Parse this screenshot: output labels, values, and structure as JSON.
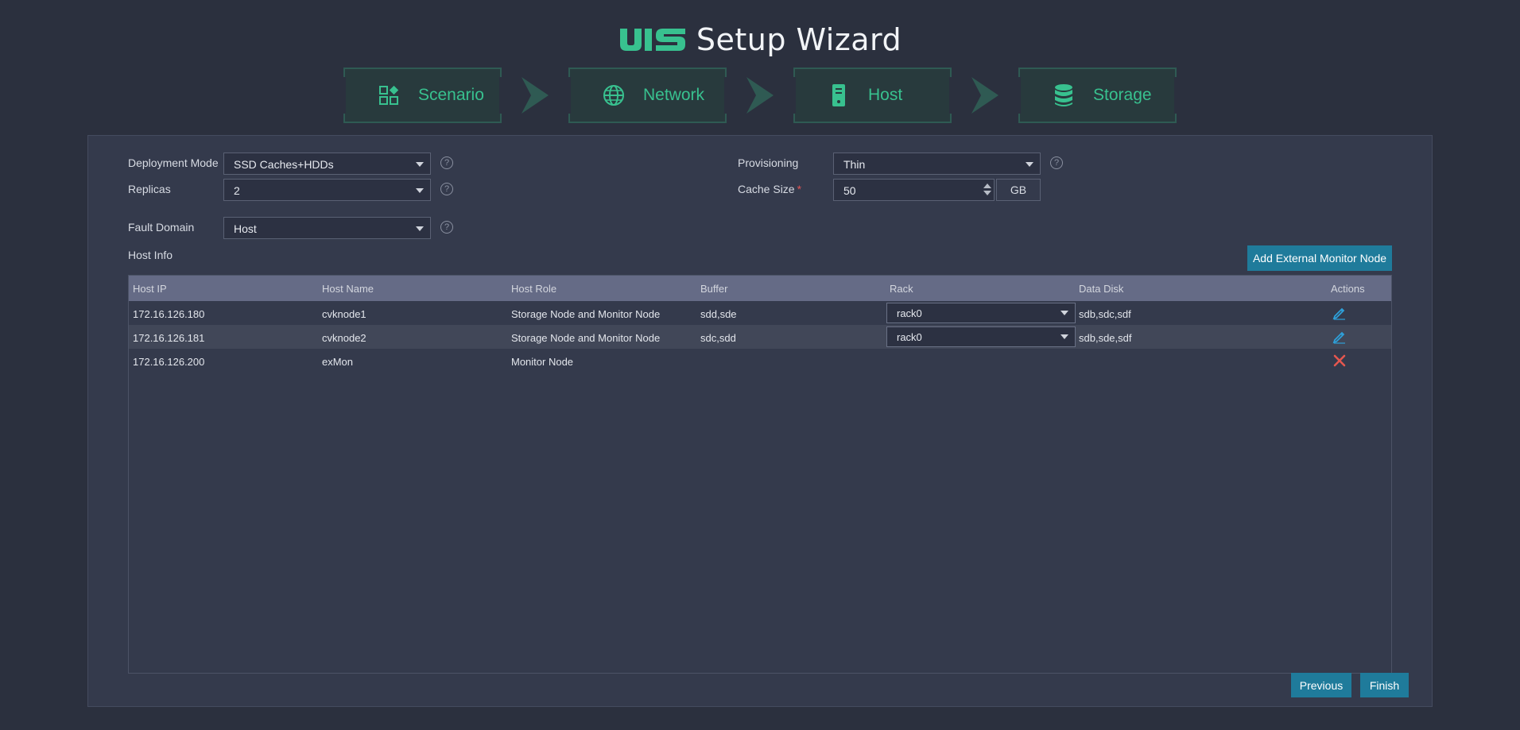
{
  "header": {
    "title": "Setup Wizard",
    "logo_text": "UIS"
  },
  "steps": [
    {
      "label": "Scenario",
      "icon": "scenario-icon"
    },
    {
      "label": "Network",
      "icon": "globe-icon"
    },
    {
      "label": "Host",
      "icon": "server-icon"
    },
    {
      "label": "Storage",
      "icon": "database-icon"
    }
  ],
  "form": {
    "deployment_mode": {
      "label": "Deployment Mode",
      "value": "SSD Caches+HDDs"
    },
    "replicas": {
      "label": "Replicas",
      "value": "2"
    },
    "fault_domain": {
      "label": "Fault Domain",
      "value": "Host"
    },
    "provisioning": {
      "label": "Provisioning",
      "value": "Thin"
    },
    "cache_size": {
      "label": "Cache Size",
      "required_mark": "*",
      "value": "50",
      "unit": "GB"
    },
    "help_glyph": "?"
  },
  "host_info": {
    "label": "Host Info",
    "add_button": "Add External Monitor Node",
    "columns": [
      "Host IP",
      "Host Name",
      "Host Role",
      "Buffer",
      "Rack",
      "Data Disk",
      "Actions"
    ],
    "rows": [
      {
        "ip": "172.16.126.180",
        "name": "cvknode1",
        "role": "Storage Node and Monitor Node",
        "buffer": "sdd,sde",
        "rack": "rack0",
        "disk": "sdb,sdc,sdf",
        "action": "edit-icon"
      },
      {
        "ip": "172.16.126.181",
        "name": "cvknode2",
        "role": "Storage Node and Monitor Node",
        "buffer": "sdc,sdd",
        "rack": "rack0",
        "disk": "sdb,sde,sdf",
        "action": "edit-icon"
      },
      {
        "ip": "172.16.126.200",
        "name": "exMon",
        "role": "Monitor Node",
        "buffer": "",
        "rack": "",
        "disk": "",
        "action": "delete-icon"
      }
    ]
  },
  "footer": {
    "previous": "Previous",
    "finish": "Finish"
  },
  "colors": {
    "accent": "#38c18f",
    "button": "#1f7b9b",
    "delete": "#e5574f",
    "edit": "#2e9fd8"
  }
}
